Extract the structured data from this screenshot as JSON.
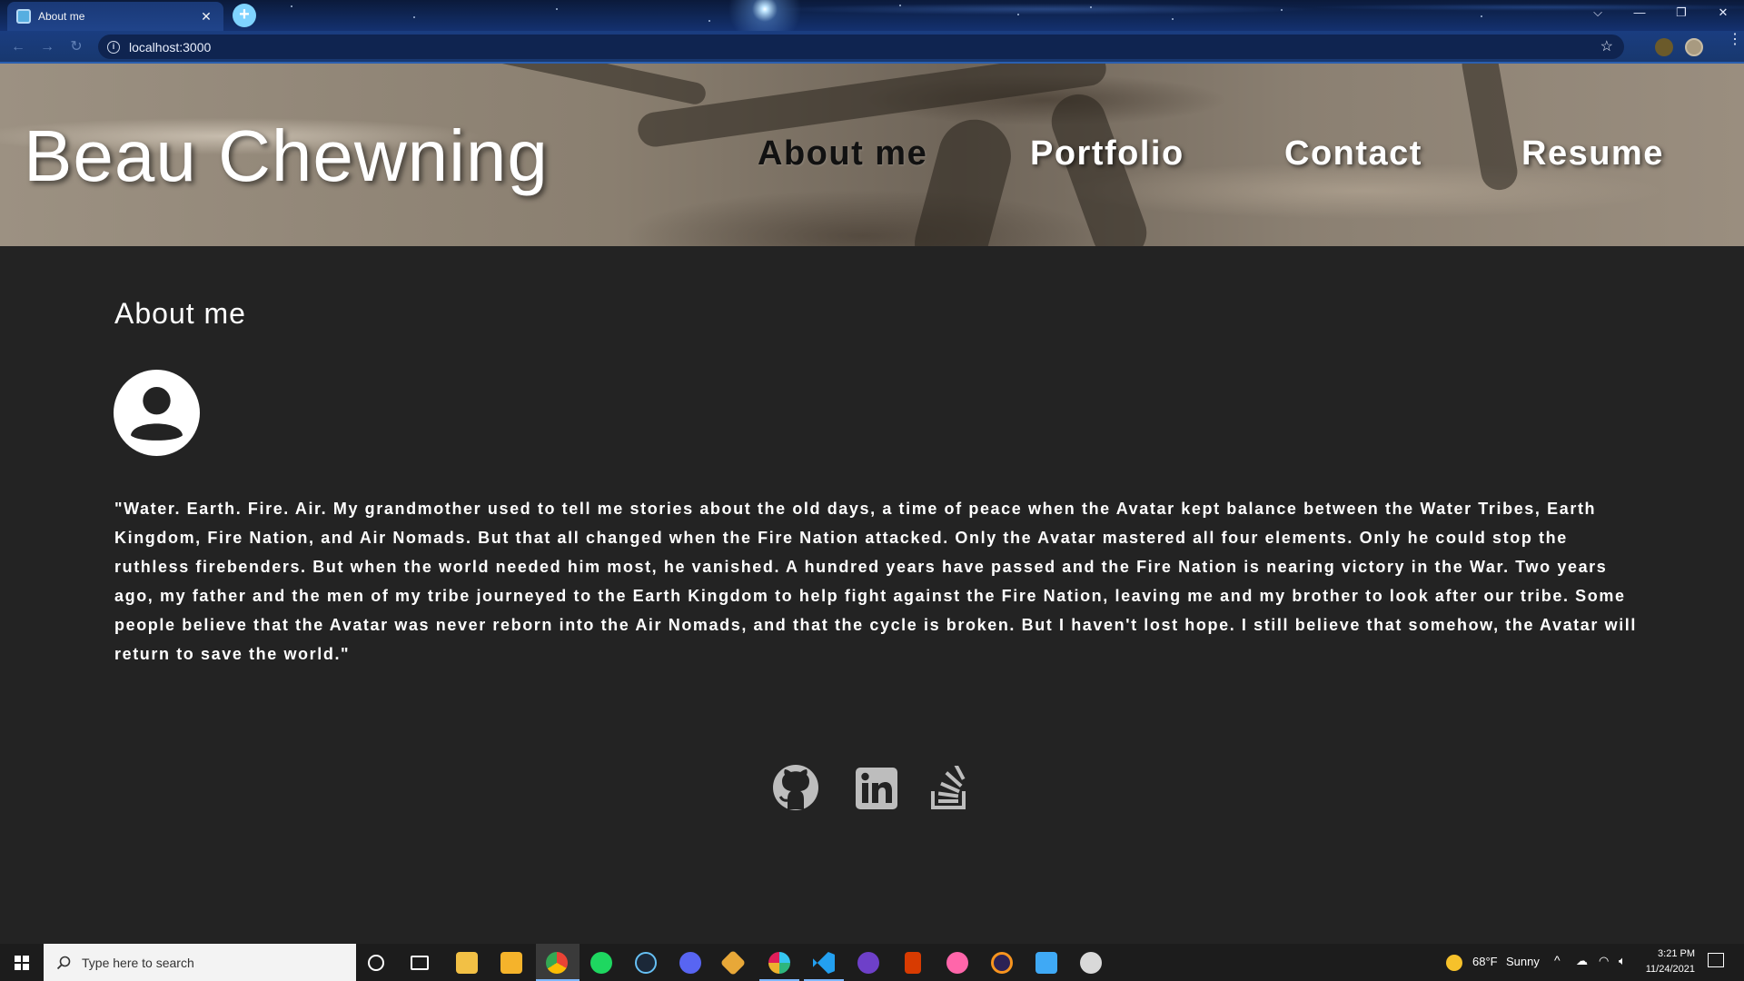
{
  "browser": {
    "tab_title": "About me",
    "url": "localhost:3000",
    "icons": [
      "back-arrow-icon",
      "forward-arrow-icon",
      "reload-icon",
      "info-icon",
      "bookmark-star-icon",
      "extension-icon",
      "profile-avatar-icon",
      "menu-icon"
    ]
  },
  "site": {
    "title": "Beau Chewning",
    "nav": [
      {
        "label": "About me",
        "active": true
      },
      {
        "label": "Portfolio",
        "active": false
      },
      {
        "label": "Contact",
        "active": false
      },
      {
        "label": "Resume",
        "active": false
      }
    ]
  },
  "main": {
    "heading": "About me",
    "avatar_icon": "user-circle-icon",
    "bio": "\"Water. Earth. Fire. Air. My grandmother used to tell me stories about the old days, a time of peace when the Avatar kept balance between the Water Tribes, Earth Kingdom, Fire Nation, and Air Nomads. But that all changed when the Fire Nation attacked. Only the Avatar mastered all four elements. Only he could stop the ruthless firebenders. But when the world needed him most, he vanished. A hundred years have passed and the Fire Nation is nearing victory in the War. Two years ago, my father and the men of my tribe journeyed to the Earth Kingdom to help fight against the Fire Nation, leaving me and my brother to look after our tribe. Some people believe that the Avatar was never reborn into the Air Nomads, and that the cycle is broken. But I haven't lost hope. I still believe that somehow, the Avatar will return to save the world.\"",
    "socials": [
      "github-icon",
      "linkedin-icon",
      "stackoverflow-icon"
    ]
  },
  "taskbar": {
    "search_placeholder": "Type here to search",
    "weather_temp": "68°F",
    "weather_text": "Sunny",
    "time": "3:21 PM",
    "date": "11/24/2021",
    "apps": [
      "cortana-icon",
      "task-view-icon",
      "file-explorer-icon",
      "store-icon",
      "chrome-icon",
      "spotify-icon",
      "steam-icon",
      "discord-icon",
      "git-icon",
      "slack-icon",
      "vscode-icon",
      "github-desktop-icon",
      "office-icon",
      "osu-icon",
      "eclipse-icon",
      "paint-icon",
      "app-icon"
    ]
  },
  "colors": {
    "page_bg": "#232323",
    "text": "#ffffff",
    "nav_active": "#111111",
    "social_icon": "#bdbdbd"
  }
}
